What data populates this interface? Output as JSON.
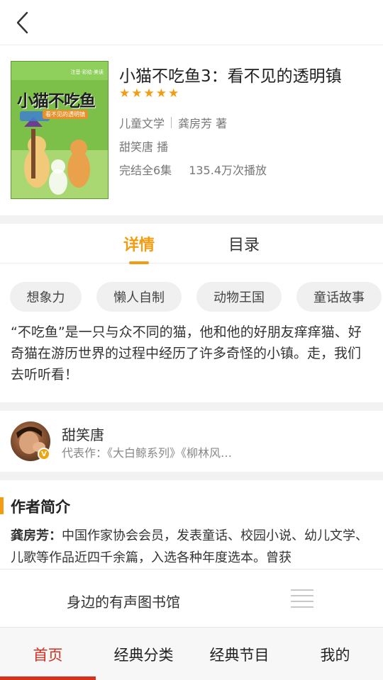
{
  "header": {
    "back_icon": "chevron-left-icon"
  },
  "book": {
    "title": "小猫不吃鱼3：看不见的透明镇",
    "rating_stars": 5,
    "category": "儿童文学",
    "author": "龚房芳 著",
    "narrator_line": "甜笑唐 播",
    "episodes": "完结全6集",
    "plays": "135.4万次播放",
    "cover": {
      "title_text": "小猫不吃鱼",
      "subtitle_text": "看不见的透明镇",
      "corner_text": "注音·彩绘·美读"
    }
  },
  "tabs": [
    {
      "label": "详情",
      "active": true
    },
    {
      "label": "目录",
      "active": false
    }
  ],
  "tags": [
    "想象力",
    "懒人自制",
    "动物王国",
    "童话故事"
  ],
  "description": "“不吃鱼”是一只与众不同的猫，他和他的好朋友痒痒猫、好奇猫在游历世界的过程中经历了许多奇怪的小镇。走，我们去听听看！",
  "narrator": {
    "name": "甜笑唐",
    "badge": "V",
    "works": "代表作：《大白鲸系列》《柳林风…"
  },
  "author_section": {
    "title": "作者简介",
    "name": "龚房芳：",
    "bio": "中国作家协会会员，发表童话、校园小说、幼儿文学、儿歌等作品近四千余篇，入选各种年度选本。曾获"
  },
  "player": {
    "title": "身边的有声图书馆",
    "playlist_icon": "playlist-icon"
  },
  "bottom_nav": [
    {
      "label": "首页",
      "active": true
    },
    {
      "label": "经典分类",
      "active": false
    },
    {
      "label": "经典节目",
      "active": false
    },
    {
      "label": "我的",
      "active": false
    }
  ],
  "colors": {
    "accent": "#f39c12",
    "nav_active": "#d6301f"
  }
}
